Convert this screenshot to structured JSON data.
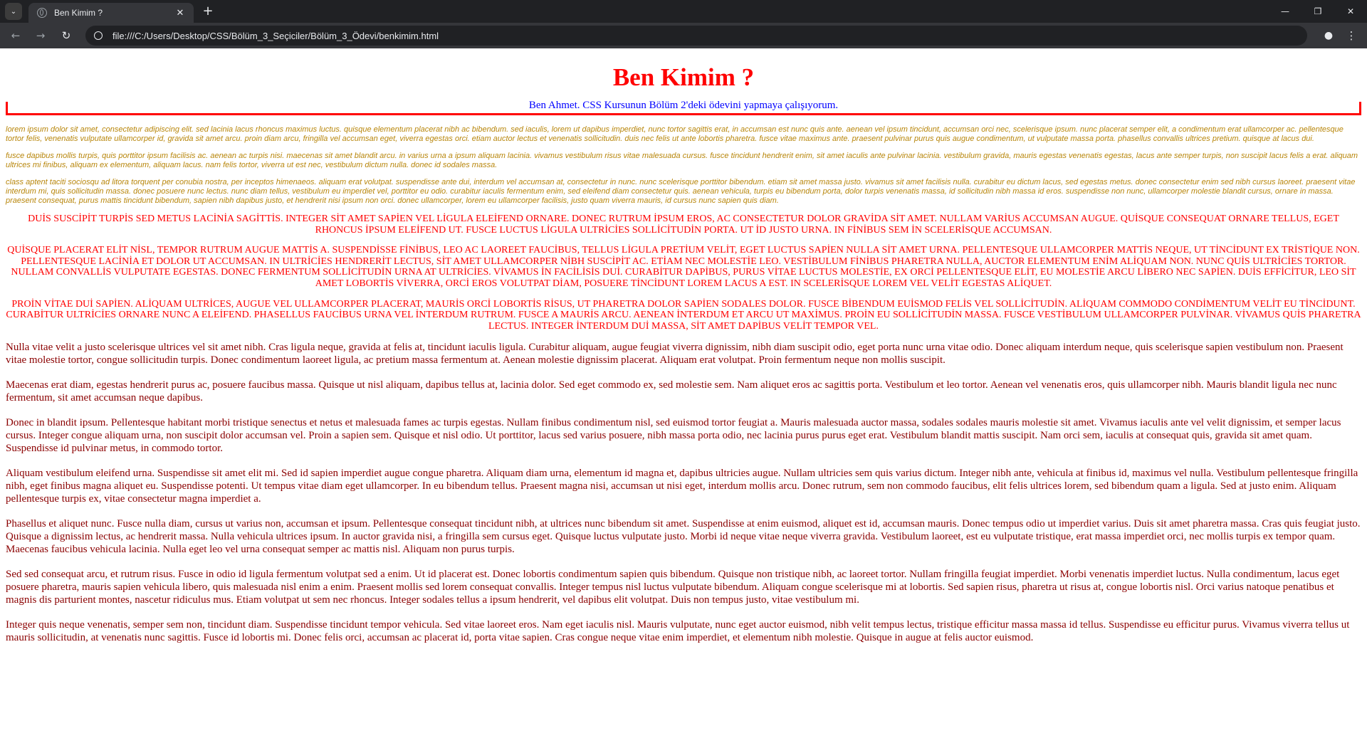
{
  "browser": {
    "tab_title": "Ben Kimim ?",
    "url": "file:///C:/Users/Desktop/CSS/Bölüm_3_Seçiciler/Bölüm_3_Ödevi/benkimim.html",
    "icons": {
      "tab_search": "chevron-down-icon",
      "close": "close-icon",
      "new_tab": "plus-icon",
      "back": "arrow-left-icon",
      "forward": "arrow-right-icon",
      "reload": "reload-icon",
      "site_info": "site-info-icon",
      "profile": "profile-icon",
      "menu": "kebab-menu-icon"
    }
  },
  "page": {
    "title": "Ben Kimim ?",
    "intro": "Ben Ahmet. CSS Kursunun Bölüm 2'deki ödevini yapmaya çalışıyorum.",
    "colors": {
      "title": "#ff0000",
      "intro": "#0000ff",
      "border": "#ff0000",
      "italic_text": "#b8860b",
      "upper_text": "#ff0000",
      "body_text": "#8b0000"
    },
    "sans_paragraphs": [
      "lorem ipsum dolor sit amet, consectetur adipiscing elit. sed lacinia lacus rhoncus maximus luctus. quisque elementum placerat nibh ac bibendum. sed iaculis, lorem ut dapibus imperdiet, nunc tortor sagittis erat, in accumsan est nunc quis ante. aenean vel ipsum tincidunt, accumsan orci nec, scelerisque ipsum. nunc placerat semper elit, a condimentum erat ullamcorper ac. pellentesque tortor felis, venenatis vulputate ullamcorper id, gravida sit amet arcu. proin diam arcu, fringilla vel accumsan eget, viverra egestas orci. etiam auctor lectus et venenatis sollicitudin. duis nec felis ut ante lobortis pharetra. fusce vitae maximus ante. praesent pulvinar purus quis augue condimentum, ut vulputate massa porta. phasellus convallis ultrices pretium. quisque at lacus dui.",
      "fusce dapibus mollis turpis, quis porttitor ipsum facilisis ac. aenean ac turpis nisi. maecenas sit amet blandit arcu. in varius urna a ipsum aliquam lacinia. vivamus vestibulum risus vitae malesuada cursus. fusce tincidunt hendrerit enim, sit amet iaculis ante pulvinar lacinia. vestibulum gravida, mauris egestas venenatis egestas, lacus ante semper turpis, non suscipit lacus felis a erat. aliquam ultrices mi finibus, aliquam ex elementum, aliquam lacus. nam felis tortor, viverra ut est nec, vestibulum dictum nulla. donec id sodales massa.",
      "class aptent taciti sociosqu ad litora torquent per conubia nostra, per inceptos himenaeos. aliquam erat volutpat. suspendisse ante dui, interdum vel accumsan at, consectetur in nunc. nunc scelerisque porttitor bibendum. etiam sit amet massa justo. vivamus sit amet facilisis nulla. curabitur eu dictum lacus, sed egestas metus. donec consectetur enim sed nibh cursus laoreet. praesent vitae interdum mi, quis sollicitudin massa. donec posuere nunc lectus. nunc diam tellus, vestibulum eu imperdiet vel, porttitor eu odio. curabitur iaculis fermentum enim, sed eleifend diam consectetur quis. aenean vehicula, turpis eu bibendum porta, dolor turpis venenatis massa, id sollicitudin nibh massa id eros. suspendisse non nunc, ullamcorper molestie blandit cursus, ornare in massa. praesent consequat, purus mattis tincidunt bibendum, sapien nibh dapibus justo, et hendrerit nisi ipsum non orci. donec ullamcorper, lorem eu ullamcorper facilisis, justo quam viverra mauris, id cursus nunc sapien quis diam."
    ],
    "upper_paragraphs": [
      "DUİS SUSCİPİT TURPİS SED METUS LACİNİA SAGİTTİS. INTEGER SİT AMET SAPİEN VEL LİGULA ELEİFEND ORNARE. DONEC RUTRUM İPSUM EROS, AC CONSECTETUR DOLOR GRAVİDA SİT AMET. NULLAM VARİUS ACCUMSAN AUGUE. QUİSQUE CONSEQUAT ORNARE TELLUS, EGET RHONCUS İPSUM ELEİFEND UT. FUSCE LUCTUS LİGULA ULTRİCİES SOLLİCİTUDİN PORTA. UT İD JUSTO URNA. IN FİNİBUS SEM İN SCELERİSQUE ACCUMSAN.",
      "QUİSQUE PLACERAT ELİT NİSL, TEMPOR RUTRUM AUGUE MATTİS A. SUSPENDİSSE FİNİBUS, LEO AC LAOREET FAUCİBUS, TELLUS LİGULA PRETİUM VELİT, EGET LUCTUS SAPİEN NULLA SİT AMET URNA. PELLENTESQUE ULLAMCORPER MATTİS NEQUE, UT TİNCİDUNT EX TRİSTİQUE NON. PELLENTESQUE LACİNİA ET DOLOR UT ACCUMSAN. IN ULTRİCİES HENDRERİT LECTUS, SİT AMET ULLAMCORPER NİBH SUSCİPİT AC. ETİAM NEC MOLESTİE LEO. VESTİBULUM FİNİBUS PHARETRA NULLA, AUCTOR ELEMENTUM ENİM ALİQUAM NON. NUNC QUİS ULTRİCİES TORTOR. NULLAM CONVALLİS VULPUTATE EGESTAS. DONEC FERMENTUM SOLLİCİTUDİN URNA AT ULTRİCİES. VİVAMUS İN FACİLİSİS DUİ. CURABİTUR DAPİBUS, PURUS VİTAE LUCTUS MOLESTİE, EX ORCİ PELLENTESQUE ELİT, EU MOLESTİE ARCU LİBERO NEC SAPİEN. DUİS EFFİCİTUR, LEO SİT AMET LOBORTİS VİVERRA, ORCİ EROS VOLUTPAT DİAM, POSUERE TİNCİDUNT LOREM LACUS A EST. IN SCELERİSQUE LOREM VEL VELİT EGESTAS ALİQUET.",
      "PROİN VİTAE DUİ SAPİEN. ALİQUAM ULTRİCES, AUGUE VEL ULLAMCORPER PLACERAT, MAURİS ORCİ LOBORTİS RİSUS, UT PHARETRA DOLOR SAPİEN SODALES DOLOR. FUSCE BİBENDUM EUİSMOD FELİS VEL SOLLİCİTUDİN. ALİQUAM COMMODO CONDİMENTUM VELİT EU TİNCİDUNT. CURABİTUR ULTRİCİES ORNARE NUNC A ELEİFEND. PHASELLUS FAUCİBUS URNA VEL İNTERDUM RUTRUM. FUSCE A MAURİS ARCU. AENEAN İNTERDUM ET ARCU UT MAXİMUS. PROİN EU SOLLİCİTUDİN MASSA. FUSCE VESTİBULUM ULLAMCORPER PULVİNAR. VİVAMUS QUİS PHARETRA LECTUS. INTEGER İNTERDUM DUİ MASSA, SİT AMET DAPİBUS VELİT TEMPOR VEL."
    ],
    "normal_paragraphs": [
      "Nulla vitae velit a justo scelerisque ultrices vel sit amet nibh. Cras ligula neque, gravida at felis at, tincidunt iaculis ligula. Curabitur aliquam, augue feugiat viverra dignissim, nibh diam suscipit odio, eget porta nunc urna vitae odio. Donec aliquam interdum neque, quis scelerisque sapien vestibulum non. Praesent vitae molestie tortor, congue sollicitudin turpis. Donec condimentum laoreet ligula, ac pretium massa fermentum at. Aenean molestie dignissim placerat. Aliquam erat volutpat. Proin fermentum neque non mollis suscipit.",
      "Maecenas erat diam, egestas hendrerit purus ac, posuere faucibus massa. Quisque ut nisl aliquam, dapibus tellus at, lacinia dolor. Sed eget commodo ex, sed molestie sem. Nam aliquet eros ac sagittis porta. Vestibulum et leo tortor. Aenean vel venenatis eros, quis ullamcorper nibh. Mauris blandit ligula nec nunc fermentum, sit amet accumsan neque dapibus.",
      "Donec in blandit ipsum. Pellentesque habitant morbi tristique senectus et netus et malesuada fames ac turpis egestas. Nullam finibus condimentum nisl, sed euismod tortor feugiat a. Mauris malesuada auctor massa, sodales sodales mauris molestie sit amet. Vivamus iaculis ante vel velit dignissim, et semper lacus cursus. Integer congue aliquam urna, non suscipit dolor accumsan vel. Proin a sapien sem. Quisque et nisl odio. Ut porttitor, lacus sed varius posuere, nibh massa porta odio, nec lacinia purus purus eget erat. Vestibulum blandit mattis suscipit. Nam orci sem, iaculis at consequat quis, gravida sit amet quam. Suspendisse id pulvinar metus, in commodo tortor.",
      "Aliquam vestibulum eleifend urna. Suspendisse sit amet elit mi. Sed id sapien imperdiet augue congue pharetra. Aliquam diam urna, elementum id magna et, dapibus ultricies augue. Nullam ultricies sem quis varius dictum. Integer nibh ante, vehicula at finibus id, maximus vel nulla. Vestibulum pellentesque fringilla nibh, eget finibus magna aliquet eu. Suspendisse potenti. Ut tempus vitae diam eget ullamcorper. In eu bibendum tellus. Praesent magna nisi, accumsan ut nisi eget, interdum mollis arcu. Donec rutrum, sem non commodo faucibus, elit felis ultrices lorem, sed bibendum quam a ligula. Sed at justo enim. Aliquam pellentesque turpis ex, vitae consectetur magna imperdiet a.",
      "Phasellus et aliquet nunc. Fusce nulla diam, cursus ut varius non, accumsan et ipsum. Pellentesque consequat tincidunt nibh, at ultrices nunc bibendum sit amet. Suspendisse at enim euismod, aliquet est id, accumsan mauris. Donec tempus odio ut imperdiet varius. Duis sit amet pharetra massa. Cras quis feugiat justo. Quisque a dignissim lectus, ac hendrerit massa. Nulla vehicula ultrices ipsum. In auctor gravida nisi, a fringilla sem cursus eget. Quisque luctus vulputate justo. Morbi id neque vitae neque viverra gravida. Vestibulum laoreet, est eu vulputate tristique, erat massa imperdiet orci, nec mollis turpis ex tempor quam. Maecenas faucibus vehicula lacinia. Nulla eget leo vel urna consequat semper ac mattis nisl. Aliquam non purus turpis.",
      "Sed sed consequat arcu, et rutrum risus. Fusce in odio id ligula fermentum volutpat sed a enim. Ut id placerat est. Donec lobortis condimentum sapien quis bibendum. Quisque non tristique nibh, ac laoreet tortor. Nullam fringilla feugiat imperdiet. Morbi venenatis imperdiet luctus. Nulla condimentum, lacus eget posuere pharetra, mauris sapien vehicula libero, quis malesuada nisl enim a enim. Praesent mollis sed lorem consequat convallis. Integer tempus nisl luctus vulputate bibendum. Aliquam congue scelerisque mi at lobortis. Sed sapien risus, pharetra ut risus at, congue lobortis nisl. Orci varius natoque penatibus et magnis dis parturient montes, nascetur ridiculus mus. Etiam volutpat ut sem nec rhoncus. Integer sodales tellus a ipsum hendrerit, vel dapibus elit volutpat. Duis non tempus justo, vitae vestibulum mi.",
      "Integer quis neque venenatis, semper sem non, tincidunt diam. Suspendisse tincidunt tempor vehicula. Sed vitae laoreet eros. Nam eget iaculis nisl. Mauris vulputate, nunc eget auctor euismod, nibh velit tempus lectus, tristique efficitur massa massa id tellus. Suspendisse eu efficitur purus. Vivamus viverra tellus ut mauris sollicitudin, at venenatis nunc sagittis. Fusce id lobortis mi. Donec felis orci, accumsan ac placerat id, porta vitae sapien. Cras congue neque vitae enim imperdiet, et elementum nibh molestie. Quisque in augue at felis auctor euismod."
    ]
  }
}
